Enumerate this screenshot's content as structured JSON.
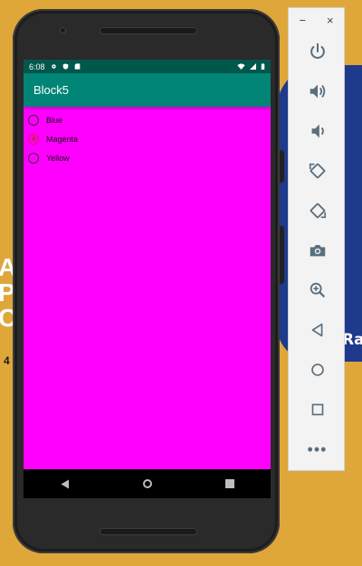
{
  "statusbar": {
    "time": "6:08"
  },
  "appbar": {
    "title": "Block5"
  },
  "radio_options": [
    {
      "label": "Blue",
      "checked": false
    },
    {
      "label": "Magenta",
      "checked": true
    },
    {
      "label": "Yellow",
      "checked": false
    }
  ],
  "toolbar": {
    "minimize_label": "−",
    "close_label": "×",
    "more_label": "•••",
    "buttons": [
      "power",
      "volume-up",
      "volume-down",
      "rotate-left",
      "rotate-right",
      "camera",
      "zoom",
      "back",
      "home",
      "overview"
    ]
  },
  "colors": {
    "screen_bg": "#FF00FF",
    "appbar": "#008577",
    "statusbar": "#00574B",
    "radio_accent": "#D81B60",
    "desktop_bg": "#DFA73A",
    "toolbar_icon": "#5A6E7D"
  },
  "background": {
    "letters": "A\nP\nC",
    "number": "4",
    "right_text": "Ra"
  }
}
